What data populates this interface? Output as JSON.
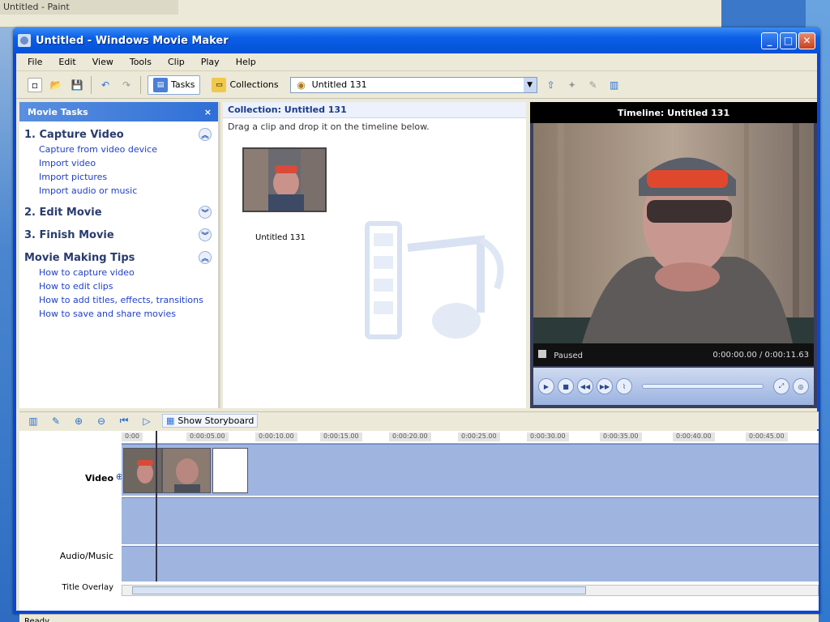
{
  "background_window": {
    "title": "Untitled - Paint"
  },
  "window": {
    "title": "Untitled - Windows Movie Maker"
  },
  "menu": [
    "File",
    "Edit",
    "View",
    "Tools",
    "Clip",
    "Play",
    "Help"
  ],
  "toolbar": {
    "tasks_label": "Tasks",
    "collections_label": "Collections",
    "collection_combo": "Untitled 131"
  },
  "taskpane": {
    "header": "Movie Tasks",
    "sections": [
      {
        "title": "1. Capture Video",
        "links": [
          "Capture from video device",
          "Import video",
          "Import pictures",
          "Import audio or music"
        ]
      },
      {
        "title": "2. Edit Movie",
        "links": []
      },
      {
        "title": "3. Finish Movie",
        "links": []
      },
      {
        "title": "Movie Making Tips",
        "links": [
          "How to capture video",
          "How to edit clips",
          "How to add titles, effects, transitions",
          "How to save and share movies"
        ]
      }
    ]
  },
  "collection": {
    "title": "Collection: Untitled 131",
    "subtitle": "Drag a clip and drop it on the timeline below.",
    "clip_label": "Untitled 131"
  },
  "monitor": {
    "title": "Timeline: Untitled 131",
    "status": "Paused",
    "time": "0:00:00.00 / 0:00:11.63"
  },
  "storyboard": {
    "toggle_label": "Show Storyboard"
  },
  "timeline": {
    "tracks": [
      "Video",
      "Audio/Music",
      "Title Overlay"
    ],
    "ruler": [
      "0:00",
      "0:00:05.00",
      "0:00:10.00",
      "0:00:15.00",
      "0:00:20.00",
      "0:00:25.00",
      "0:00:30.00",
      "0:00:35.00",
      "0:00:40.00",
      "0:00:45.00"
    ]
  },
  "statusbar": {
    "text": "Ready"
  },
  "colors": {
    "title_bar": "#0451d6",
    "task_header": "#2f6fd6",
    "track_fill": "#9fb5df",
    "link": "#2140c8"
  }
}
